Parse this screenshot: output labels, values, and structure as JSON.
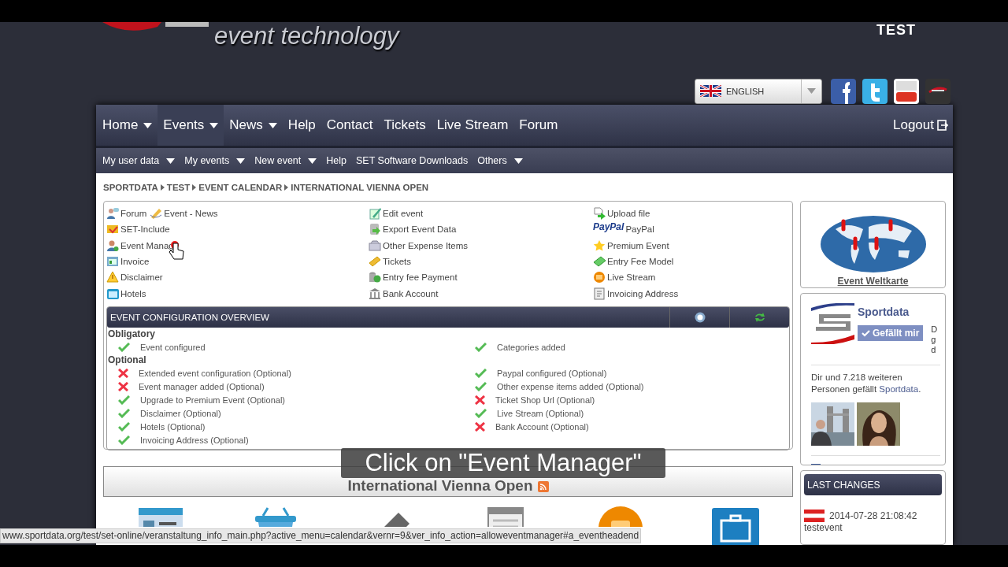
{
  "header": {
    "logo_text": "event technology",
    "site_label": "TEST",
    "language": "ENGLISH"
  },
  "main_nav": {
    "items": [
      {
        "label": "Home",
        "selected": false,
        "has_menu": true
      },
      {
        "label": "Events",
        "selected": true,
        "has_menu": true
      },
      {
        "label": "News",
        "selected": false,
        "has_menu": true
      },
      {
        "label": "Help",
        "selected": false,
        "has_menu": false
      },
      {
        "label": "Contact",
        "selected": false,
        "has_menu": false
      },
      {
        "label": "Tickets",
        "selected": false,
        "has_menu": false
      },
      {
        "label": "Live Stream",
        "selected": false,
        "has_menu": false
      },
      {
        "label": "Forum",
        "selected": false,
        "has_menu": false
      }
    ],
    "logout": "Logout"
  },
  "sub_nav": [
    {
      "label": "My user data",
      "has_menu": true
    },
    {
      "label": "My events",
      "has_menu": true
    },
    {
      "label": "New event",
      "has_menu": true
    },
    {
      "label": "Help",
      "has_menu": false
    },
    {
      "label": "SET Software Downloads",
      "has_menu": false
    },
    {
      "label": "Others",
      "has_menu": true
    }
  ],
  "breadcrumb": [
    "SPORTDATA",
    "TEST",
    "EVENT CALENDAR",
    "INTERNATIONAL VIENNA OPEN"
  ],
  "action_links": [
    [
      [
        {
          "label": "Forum",
          "kind": "forum"
        },
        {
          "label": "Event - News",
          "kind": "news"
        }
      ],
      [
        {
          "label": "SET-Include",
          "kind": "css"
        }
      ],
      [
        {
          "label": "Event Manag",
          "kind": "manager"
        }
      ],
      [
        {
          "label": "Invoice",
          "kind": "invoice"
        }
      ],
      [
        {
          "label": "Disclaimer",
          "kind": "warning"
        }
      ],
      [
        {
          "label": "Hotels",
          "kind": "hotels"
        }
      ]
    ],
    [
      [
        {
          "label": "Edit event",
          "kind": "edit"
        }
      ],
      [
        {
          "label": "Export Event Data",
          "kind": "export"
        }
      ],
      [
        {
          "label": "Other Expense Items",
          "kind": "expense"
        }
      ],
      [
        {
          "label": "Tickets",
          "kind": "tickets"
        }
      ],
      [
        {
          "label": "Entry fee Payment",
          "kind": "payment"
        }
      ],
      [
        {
          "label": "Bank Account",
          "kind": "bank"
        }
      ]
    ],
    [
      [
        {
          "label": "Upload file",
          "kind": "upload"
        }
      ],
      [
        {
          "label": "PayPal",
          "kind": "paypal",
          "logo_text": "PayPal"
        }
      ],
      [
        {
          "label": "Premium Event",
          "kind": "star"
        }
      ],
      [
        {
          "label": "Entry Fee Model",
          "kind": "money"
        }
      ],
      [
        {
          "label": "Live Stream",
          "kind": "stream"
        }
      ],
      [
        {
          "label": "Invoicing Address",
          "kind": "address"
        }
      ]
    ]
  ],
  "overview": {
    "title": "EVENT CONFIGURATION OVERVIEW",
    "groups": [
      {
        "title": "Obligatory",
        "left": [
          {
            "label": "Event configured",
            "done": true
          }
        ],
        "right": [
          {
            "label": "Categories added",
            "done": true
          }
        ]
      },
      {
        "title": "Optional",
        "left": [
          {
            "label": "Extended event configuration (Optional)",
            "done": false
          },
          {
            "label": "Event manager added (Optional)",
            "done": false
          },
          {
            "label": "Upgrade to Premium Event (Optional)",
            "done": true
          },
          {
            "label": "Disclaimer (Optional)",
            "done": true
          },
          {
            "label": "Hotels (Optional)",
            "done": true
          },
          {
            "label": "Invoicing Address (Optional)",
            "done": true
          }
        ],
        "right": [
          {
            "label": "Paypal configured (Optional)",
            "done": true
          },
          {
            "label": "Other expense items added (Optional)",
            "done": true
          },
          {
            "label": "Ticket Shop Url (Optional)",
            "done": false
          },
          {
            "label": "Live Stream (Optional)",
            "done": true
          },
          {
            "label": "Bank Account (Optional)",
            "done": false
          }
        ]
      }
    ]
  },
  "event_title": "International Vienna Open",
  "sidebar": {
    "map_link": "Event Weltkarte",
    "facebook": {
      "page_name": "Sportdata",
      "like_button": "Gefällt mir",
      "cut_text": [
        "D",
        "g",
        "d"
      ],
      "text_before": "Dir und 7.218 weiteren Personen gefällt ",
      "link": "Sportdata",
      "text_after": "."
    },
    "last_changes": {
      "title": "LAST CHANGES",
      "entries": [
        {
          "time": "2014-07-28 21:08:42",
          "name": "testevent"
        }
      ]
    }
  },
  "status_url": "www.sportdata.org/test/set-online/veranstaltung_info_main.php?active_menu=calendar&vernr=9&ver_info_action=alloweventmanager#a_eventheadend",
  "caption": "Click on \"Event Manager\""
}
